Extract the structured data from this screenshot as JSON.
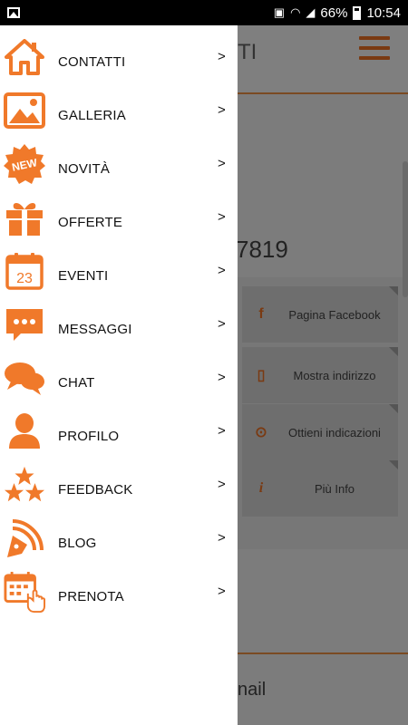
{
  "status_bar": {
    "battery": "66%",
    "time": "10:54"
  },
  "background": {
    "title_fragment": "TI",
    "phone_fragment": "7819",
    "buttons": [
      {
        "label": "Pagina Facebook",
        "icon": "facebook-icon"
      },
      {
        "label": "Mostra indirizzo",
        "icon": "map-icon"
      },
      {
        "label": "Ottieni indicazioni",
        "icon": "location-pin-icon"
      },
      {
        "label": "Più Info",
        "icon": "info-icon"
      }
    ],
    "email_fragment": "nail"
  },
  "drawer": {
    "arrow": ">",
    "accent_color": "#f0792a",
    "items": [
      {
        "label": "CONTATTI",
        "icon": "home-icon"
      },
      {
        "label": "GALLERIA",
        "icon": "gallery-icon"
      },
      {
        "label": "NOVITÀ",
        "icon": "new-badge-icon",
        "badge": "NEW"
      },
      {
        "label": "OFFERTE",
        "icon": "gift-icon"
      },
      {
        "label": "EVENTI",
        "icon": "calendar-icon",
        "day": "23"
      },
      {
        "label": "MESSAGGI",
        "icon": "message-icon"
      },
      {
        "label": "CHAT",
        "icon": "chat-icon"
      },
      {
        "label": "PROFILO",
        "icon": "profile-icon"
      },
      {
        "label": "FEEDBACK",
        "icon": "stars-icon"
      },
      {
        "label": "BLOG",
        "icon": "blog-pen-icon"
      },
      {
        "label": "PRENOTA",
        "icon": "booking-icon"
      }
    ]
  }
}
